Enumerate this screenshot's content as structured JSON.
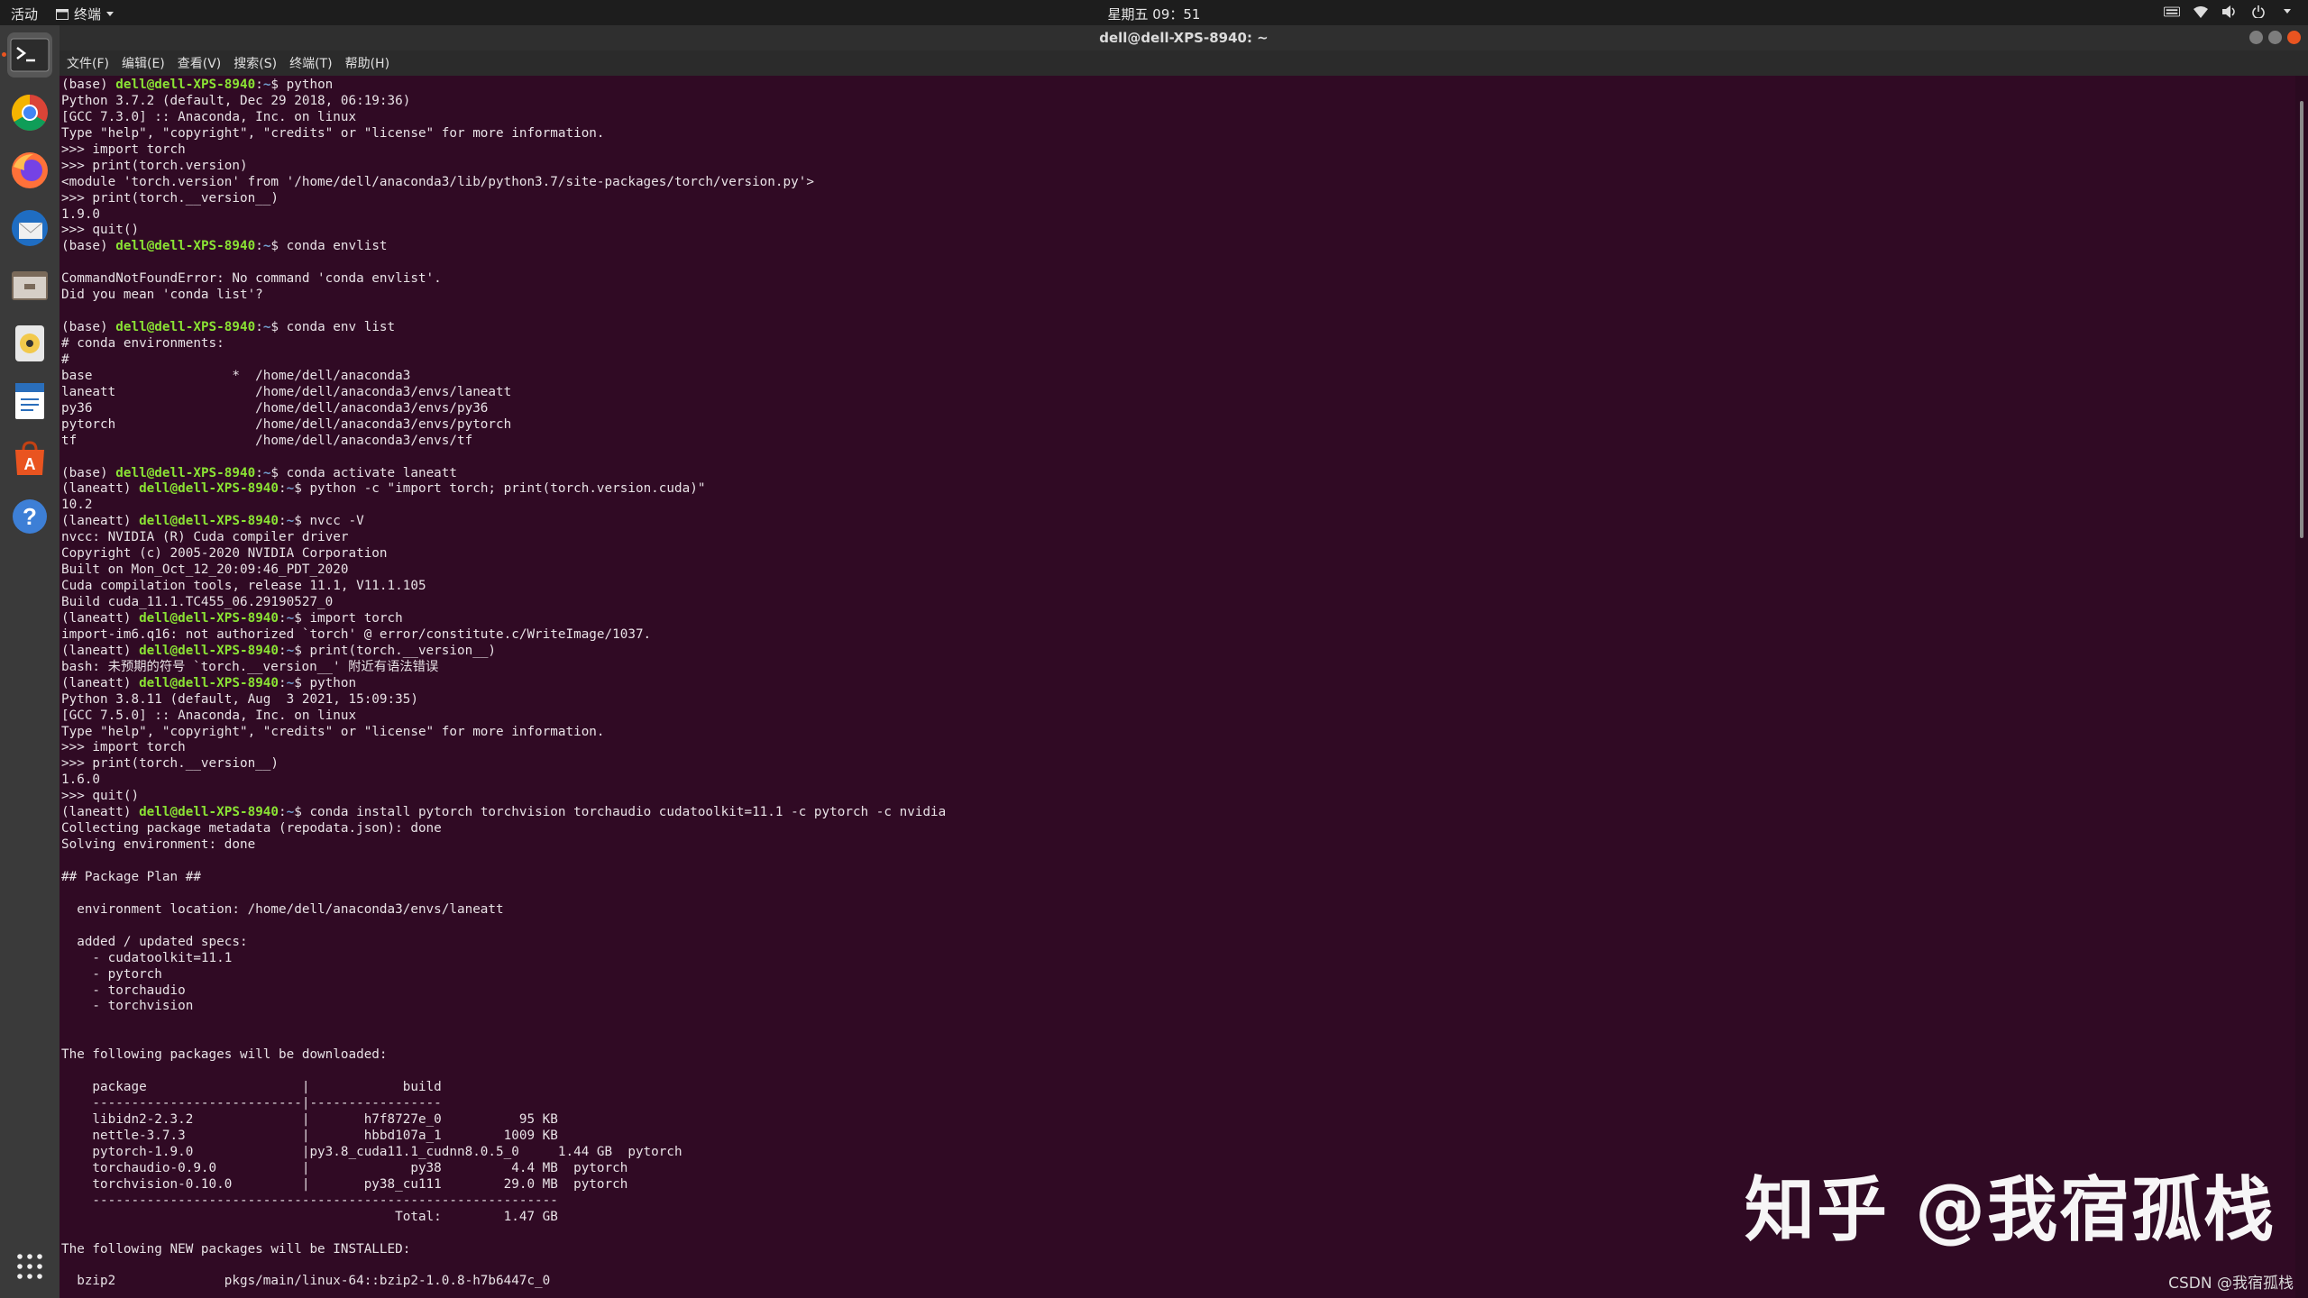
{
  "topbar": {
    "activities": "活动",
    "app_menu": "终端",
    "clock": "星期五 09：51"
  },
  "window": {
    "title": "dell@dell-XPS-8940: ~"
  },
  "menu": [
    "文件(F)",
    "编辑(E)",
    "查看(V)",
    "搜索(S)",
    "终端(T)",
    "帮助(H)"
  ],
  "dock": [
    {
      "name": "terminal",
      "icon": "terminal-icon"
    },
    {
      "name": "chrome",
      "icon": "chrome-icon"
    },
    {
      "name": "firefox",
      "icon": "firefox-icon"
    },
    {
      "name": "thunderbird",
      "icon": "thunderbird-icon"
    },
    {
      "name": "files",
      "icon": "files-icon"
    },
    {
      "name": "rhythmbox",
      "icon": "rhythmbox-icon"
    },
    {
      "name": "writer",
      "icon": "writer-icon"
    },
    {
      "name": "software",
      "icon": "software-icon"
    },
    {
      "name": "help",
      "icon": "help-icon"
    }
  ],
  "show_apps_icon": "apps-grid-icon",
  "terminal_lines": [
    {
      "segs": [
        [
          "t",
          "(base) "
        ],
        [
          "h",
          "dell@dell-XPS-8940"
        ],
        [
          "t",
          ":"
        ],
        [
          "p",
          "~"
        ],
        [
          "t",
          "$ python"
        ]
      ]
    },
    {
      "text": "Python 3.7.2 (default, Dec 29 2018, 06:19:36)"
    },
    {
      "text": "[GCC 7.3.0] :: Anaconda, Inc. on linux"
    },
    {
      "text": "Type \"help\", \"copyright\", \"credits\" or \"license\" for more information."
    },
    {
      "text": ">>> import torch"
    },
    {
      "text": ">>> print(torch.version)"
    },
    {
      "text": "<module 'torch.version' from '/home/dell/anaconda3/lib/python3.7/site-packages/torch/version.py'>"
    },
    {
      "text": ">>> print(torch.__version__)"
    },
    {
      "text": "1.9.0"
    },
    {
      "text": ">>> quit()"
    },
    {
      "segs": [
        [
          "t",
          "(base) "
        ],
        [
          "h",
          "dell@dell-XPS-8940"
        ],
        [
          "t",
          ":"
        ],
        [
          "p",
          "~"
        ],
        [
          "t",
          "$ conda envlist"
        ]
      ]
    },
    {
      "text": ""
    },
    {
      "text": "CommandNotFoundError: No command 'conda envlist'."
    },
    {
      "text": "Did you mean 'conda list'?"
    },
    {
      "text": ""
    },
    {
      "segs": [
        [
          "t",
          "(base) "
        ],
        [
          "h",
          "dell@dell-XPS-8940"
        ],
        [
          "t",
          ":"
        ],
        [
          "p",
          "~"
        ],
        [
          "t",
          "$ conda env list"
        ]
      ]
    },
    {
      "text": "# conda environments:"
    },
    {
      "text": "#"
    },
    {
      "text": "base                  *  /home/dell/anaconda3"
    },
    {
      "text": "laneatt                  /home/dell/anaconda3/envs/laneatt"
    },
    {
      "text": "py36                     /home/dell/anaconda3/envs/py36"
    },
    {
      "text": "pytorch                  /home/dell/anaconda3/envs/pytorch"
    },
    {
      "text": "tf                       /home/dell/anaconda3/envs/tf"
    },
    {
      "text": ""
    },
    {
      "segs": [
        [
          "t",
          "(base) "
        ],
        [
          "h",
          "dell@dell-XPS-8940"
        ],
        [
          "t",
          ":"
        ],
        [
          "p",
          "~"
        ],
        [
          "t",
          "$ conda activate laneatt"
        ]
      ]
    },
    {
      "segs": [
        [
          "t",
          "(laneatt) "
        ],
        [
          "h",
          "dell@dell-XPS-8940"
        ],
        [
          "t",
          ":"
        ],
        [
          "p",
          "~"
        ],
        [
          "t",
          "$ python -c \"import torch; print(torch.version.cuda)\""
        ]
      ]
    },
    {
      "text": "10.2"
    },
    {
      "segs": [
        [
          "t",
          "(laneatt) "
        ],
        [
          "h",
          "dell@dell-XPS-8940"
        ],
        [
          "t",
          ":"
        ],
        [
          "p",
          "~"
        ],
        [
          "t",
          "$ nvcc -V"
        ]
      ]
    },
    {
      "text": "nvcc: NVIDIA (R) Cuda compiler driver"
    },
    {
      "text": "Copyright (c) 2005-2020 NVIDIA Corporation"
    },
    {
      "text": "Built on Mon_Oct_12_20:09:46_PDT_2020"
    },
    {
      "text": "Cuda compilation tools, release 11.1, V11.1.105"
    },
    {
      "text": "Build cuda_11.1.TC455_06.29190527_0"
    },
    {
      "segs": [
        [
          "t",
          "(laneatt) "
        ],
        [
          "h",
          "dell@dell-XPS-8940"
        ],
        [
          "t",
          ":"
        ],
        [
          "p",
          "~"
        ],
        [
          "t",
          "$ import torch"
        ]
      ]
    },
    {
      "text": "import-im6.q16: not authorized `torch' @ error/constitute.c/WriteImage/1037."
    },
    {
      "segs": [
        [
          "t",
          "(laneatt) "
        ],
        [
          "h",
          "dell@dell-XPS-8940"
        ],
        [
          "t",
          ":"
        ],
        [
          "p",
          "~"
        ],
        [
          "t",
          "$ print(torch.__version__)"
        ]
      ]
    },
    {
      "text": "bash: 未预期的符号 `torch.__version__' 附近有语法错误"
    },
    {
      "segs": [
        [
          "t",
          "(laneatt) "
        ],
        [
          "h",
          "dell@dell-XPS-8940"
        ],
        [
          "t",
          ":"
        ],
        [
          "p",
          "~"
        ],
        [
          "t",
          "$ python"
        ]
      ]
    },
    {
      "text": "Python 3.8.11 (default, Aug  3 2021, 15:09:35)"
    },
    {
      "text": "[GCC 7.5.0] :: Anaconda, Inc. on linux"
    },
    {
      "text": "Type \"help\", \"copyright\", \"credits\" or \"license\" for more information."
    },
    {
      "text": ">>> import torch"
    },
    {
      "text": ">>> print(torch.__version__)"
    },
    {
      "text": "1.6.0"
    },
    {
      "text": ">>> quit()"
    },
    {
      "segs": [
        [
          "t",
          "(laneatt) "
        ],
        [
          "h",
          "dell@dell-XPS-8940"
        ],
        [
          "t",
          ":"
        ],
        [
          "p",
          "~"
        ],
        [
          "t",
          "$ conda install pytorch torchvision torchaudio cudatoolkit=11.1 -c pytorch -c nvidia"
        ]
      ]
    },
    {
      "text": "Collecting package metadata (repodata.json): done"
    },
    {
      "text": "Solving environment: done"
    },
    {
      "text": ""
    },
    {
      "text": "## Package Plan ##"
    },
    {
      "text": ""
    },
    {
      "text": "  environment location: /home/dell/anaconda3/envs/laneatt"
    },
    {
      "text": ""
    },
    {
      "text": "  added / updated specs:"
    },
    {
      "text": "    - cudatoolkit=11.1"
    },
    {
      "text": "    - pytorch"
    },
    {
      "text": "    - torchaudio"
    },
    {
      "text": "    - torchvision"
    },
    {
      "text": ""
    },
    {
      "text": ""
    },
    {
      "text": "The following packages will be downloaded:"
    },
    {
      "text": ""
    },
    {
      "text": "    package                    |            build"
    },
    {
      "text": "    ---------------------------|-----------------"
    },
    {
      "text": "    libidn2-2.3.2              |       h7f8727e_0          95 KB"
    },
    {
      "text": "    nettle-3.7.3               |       hbbd107a_1        1009 KB"
    },
    {
      "text": "    pytorch-1.9.0              |py3.8_cuda11.1_cudnn8.0.5_0     1.44 GB  pytorch"
    },
    {
      "text": "    torchaudio-0.9.0           |             py38         4.4 MB  pytorch"
    },
    {
      "text": "    torchvision-0.10.0         |       py38_cu111        29.0 MB  pytorch"
    },
    {
      "text": "    ------------------------------------------------------------"
    },
    {
      "text": "                                           Total:        1.47 GB"
    },
    {
      "text": ""
    },
    {
      "text": "The following NEW packages will be INSTALLED:"
    },
    {
      "text": ""
    },
    {
      "text": "  bzip2              pkgs/main/linux-64::bzip2-1.0.8-h7b6447c_0"
    }
  ],
  "watermark": "知乎 @我宿孤栈",
  "csdn_credit": "CSDN @我宿孤栈"
}
